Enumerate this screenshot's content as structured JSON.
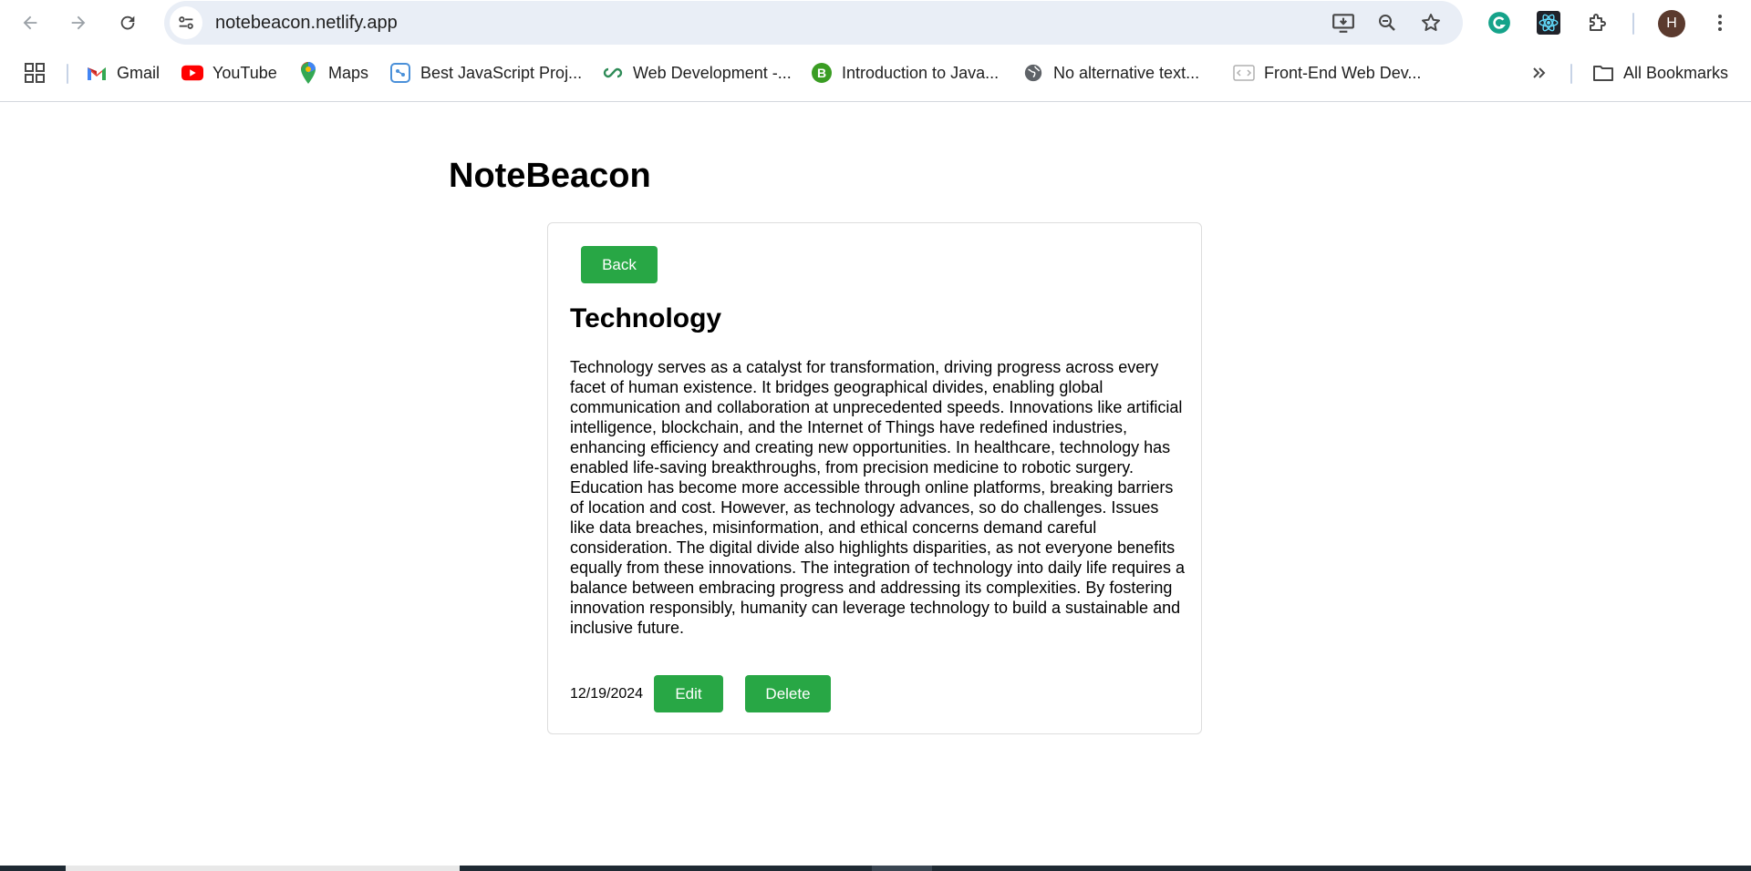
{
  "browser": {
    "url": "notebeacon.netlify.app",
    "profile_initial": "H",
    "accent_color": "#28a745",
    "bookmarks": [
      {
        "label": "Gmail",
        "icon": "gmail-icon"
      },
      {
        "label": "YouTube",
        "icon": "youtube-icon"
      },
      {
        "label": "Maps",
        "icon": "maps-icon"
      },
      {
        "label": "Best JavaScript Proj...",
        "icon": "brain-icon"
      },
      {
        "label": "Web Development -...",
        "icon": "link-icon"
      },
      {
        "label": "Introduction to Java...",
        "icon": "b-icon"
      },
      {
        "label": "No alternative text...",
        "icon": "globe-icon"
      },
      {
        "label": "Front-End Web Dev...",
        "icon": "code-icon"
      }
    ],
    "all_bookmarks_label": "All Bookmarks"
  },
  "app": {
    "title": "NoteBeacon"
  },
  "note": {
    "back_label": "Back",
    "title": "Technology",
    "body": "Technology serves as a catalyst for transformation, driving progress across every facet of human existence. It bridges geographical divides, enabling global communication and collaboration at unprecedented speeds. Innovations like artificial intelligence, blockchain, and the Internet of Things have redefined industries, enhancing efficiency and creating new opportunities. In healthcare, technology has enabled life-saving breakthroughs, from precision medicine to robotic surgery. Education has become more accessible through online platforms, breaking barriers of location and cost. However, as technology advances, so do challenges. Issues like data breaches, misinformation, and ethical concerns demand careful consideration. The digital divide also highlights disparities, as not everyone benefits equally from these innovations. The integration of technology into daily life requires a balance between embracing progress and addressing its complexities. By fostering innovation responsibly, humanity can leverage technology to build a sustainable and inclusive future.",
    "date": "12/19/2024",
    "edit_label": "Edit",
    "delete_label": "Delete"
  }
}
